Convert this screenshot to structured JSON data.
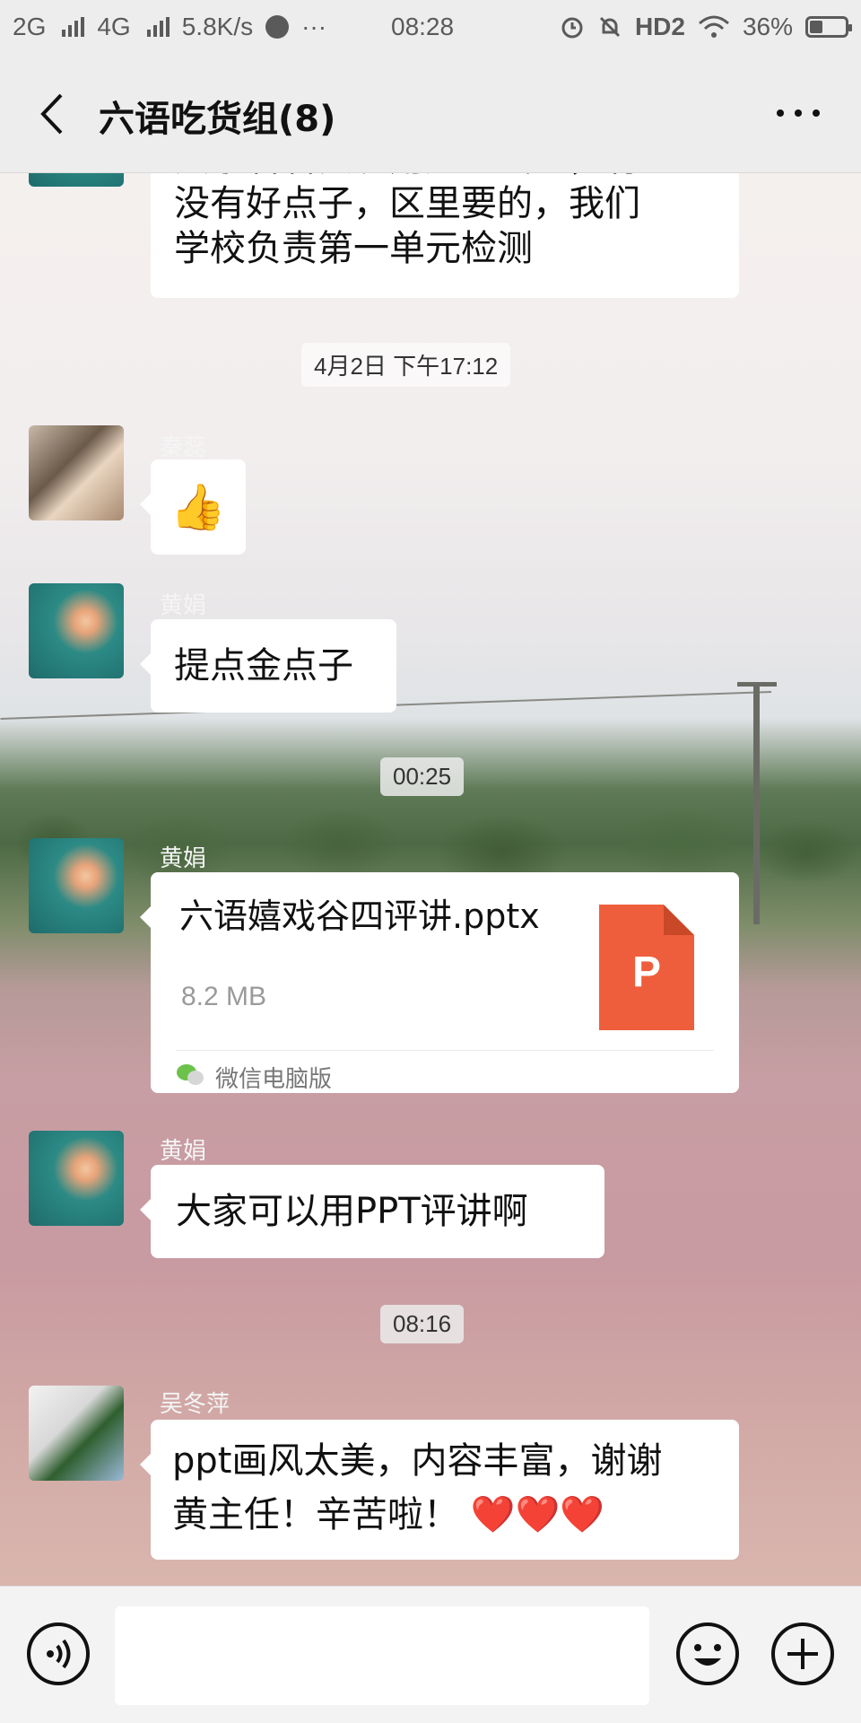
{
  "status_bar": {
    "network1": "2G",
    "network2": "4G",
    "speed": "5.8K/s",
    "dots": "···",
    "time": "08:28",
    "hd": "HD2",
    "battery": "36%",
    "battery_level": 0.36
  },
  "nav": {
    "title": "六语吃货组(8)"
  },
  "messages": {
    "m0_text": "大家有看实况用还的试态，有没有好点子，区里要的，我们学校负责第一单元检测",
    "m0_line1": "大家看看实况用还的试态，有",
    "m0_line2": "没有好点子，区里要的，我们",
    "m0_line3": "学校负责第一单元检测",
    "time1": "4月2日 下午17:12",
    "m1_sender": "秦蕊",
    "m1_emoji": "👍",
    "m2_sender": "黄娟",
    "m2_text": "提点金点子",
    "time2": "00:25",
    "m3_sender": "黄娟",
    "m3_file_name": "六语嬉戏谷四评讲.pptx",
    "m3_file_size": "8.2 MB",
    "m3_file_icon": "P",
    "m3_source": "微信电脑版",
    "m4_sender": "黄娟",
    "m4_text": "大家可以用PPT评讲啊",
    "time3": "08:16",
    "m5_sender": "吴冬萍",
    "m5_line1": "ppt画风太美，内容丰富，谢谢",
    "m5_line2": "黄主任！辛苦啦！",
    "m5_hearts": "❤️❤️❤️"
  },
  "input": {
    "placeholder": ""
  },
  "colors": {
    "bubble": "#ffffff",
    "ppt": "#ef5e3c",
    "header_bg": "#ededed"
  }
}
